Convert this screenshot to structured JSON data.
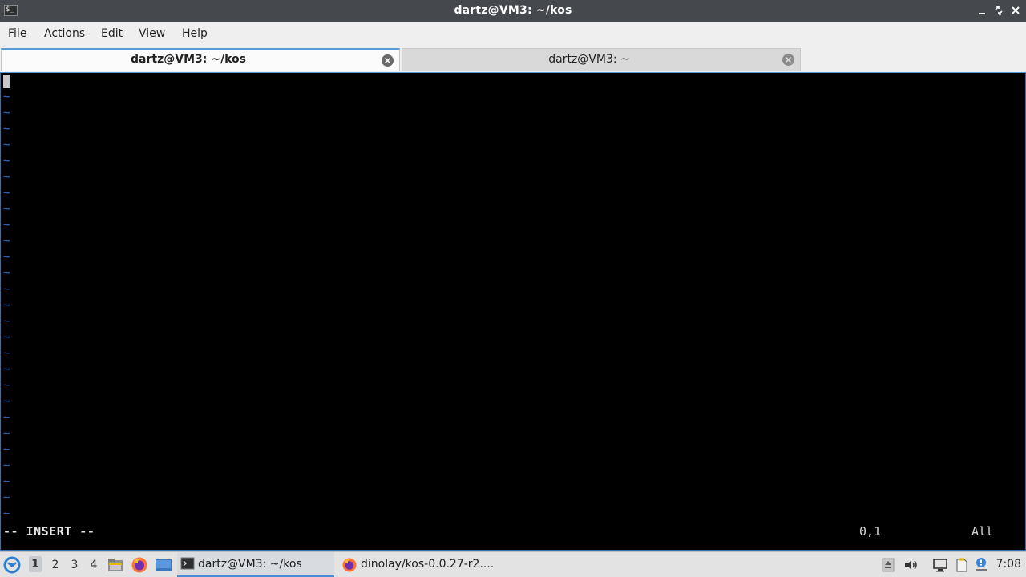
{
  "window": {
    "title": "dartz@VM3: ~/kos",
    "app_icon_glyph": "$_"
  },
  "menu": {
    "items": [
      "File",
      "Actions",
      "Edit",
      "View",
      "Help"
    ]
  },
  "tabs": [
    {
      "label": "dartz@VM3: ~/kos",
      "active": true
    },
    {
      "label": "dartz@VM3: ~",
      "active": false
    }
  ],
  "terminal": {
    "tilde_glyph": "~",
    "tilde_count": 27,
    "mode_text": "-- INSERT --",
    "cursor_position": "0,1",
    "scroll_position": "All",
    "colors": {
      "background": "#000000",
      "tilde": "#3b6fd8",
      "text": "#eaeaea"
    }
  },
  "taskbar": {
    "workspaces": [
      "1",
      "2",
      "3",
      "4"
    ],
    "active_workspace": "1",
    "launchers": [
      "start-menu-icon",
      "file-manager-icon",
      "firefox-icon",
      "desktop-icon"
    ],
    "tasks": [
      {
        "label": "dartz@VM3: ~/kos",
        "icon": "terminal-icon",
        "active": true
      },
      {
        "label": "dinolay/kos-0.0.27-r2....",
        "icon": "firefox-icon",
        "active": false
      }
    ],
    "tray_icons": [
      "upload-icon",
      "volume-icon",
      "network-icon",
      "clipboard-icon",
      "notification-icon"
    ],
    "clock": "7:08"
  },
  "accent_color": "#5b9bd5"
}
